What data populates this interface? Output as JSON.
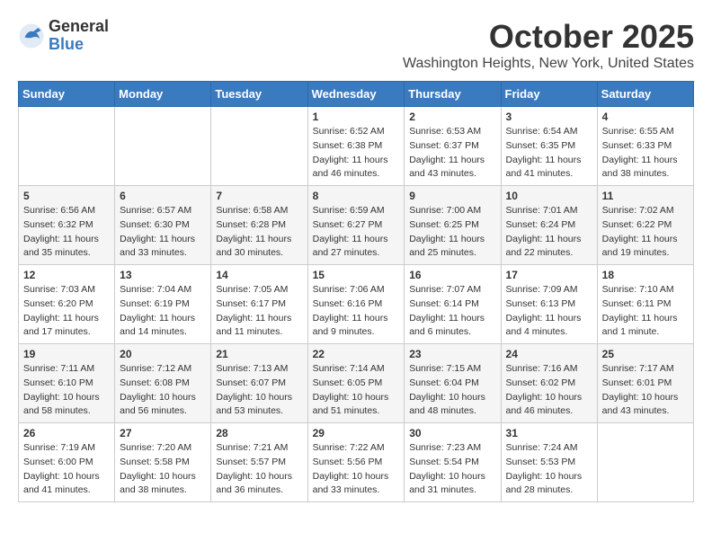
{
  "logo": {
    "general": "General",
    "blue": "Blue"
  },
  "title": "October 2025",
  "location": "Washington Heights, New York, United States",
  "days_of_week": [
    "Sunday",
    "Monday",
    "Tuesday",
    "Wednesday",
    "Thursday",
    "Friday",
    "Saturday"
  ],
  "weeks": [
    [
      {
        "day": "",
        "info": ""
      },
      {
        "day": "",
        "info": ""
      },
      {
        "day": "",
        "info": ""
      },
      {
        "day": "1",
        "info": "Sunrise: 6:52 AM\nSunset: 6:38 PM\nDaylight: 11 hours and 46 minutes."
      },
      {
        "day": "2",
        "info": "Sunrise: 6:53 AM\nSunset: 6:37 PM\nDaylight: 11 hours and 43 minutes."
      },
      {
        "day": "3",
        "info": "Sunrise: 6:54 AM\nSunset: 6:35 PM\nDaylight: 11 hours and 41 minutes."
      },
      {
        "day": "4",
        "info": "Sunrise: 6:55 AM\nSunset: 6:33 PM\nDaylight: 11 hours and 38 minutes."
      }
    ],
    [
      {
        "day": "5",
        "info": "Sunrise: 6:56 AM\nSunset: 6:32 PM\nDaylight: 11 hours and 35 minutes."
      },
      {
        "day": "6",
        "info": "Sunrise: 6:57 AM\nSunset: 6:30 PM\nDaylight: 11 hours and 33 minutes."
      },
      {
        "day": "7",
        "info": "Sunrise: 6:58 AM\nSunset: 6:28 PM\nDaylight: 11 hours and 30 minutes."
      },
      {
        "day": "8",
        "info": "Sunrise: 6:59 AM\nSunset: 6:27 PM\nDaylight: 11 hours and 27 minutes."
      },
      {
        "day": "9",
        "info": "Sunrise: 7:00 AM\nSunset: 6:25 PM\nDaylight: 11 hours and 25 minutes."
      },
      {
        "day": "10",
        "info": "Sunrise: 7:01 AM\nSunset: 6:24 PM\nDaylight: 11 hours and 22 minutes."
      },
      {
        "day": "11",
        "info": "Sunrise: 7:02 AM\nSunset: 6:22 PM\nDaylight: 11 hours and 19 minutes."
      }
    ],
    [
      {
        "day": "12",
        "info": "Sunrise: 7:03 AM\nSunset: 6:20 PM\nDaylight: 11 hours and 17 minutes."
      },
      {
        "day": "13",
        "info": "Sunrise: 7:04 AM\nSunset: 6:19 PM\nDaylight: 11 hours and 14 minutes."
      },
      {
        "day": "14",
        "info": "Sunrise: 7:05 AM\nSunset: 6:17 PM\nDaylight: 11 hours and 11 minutes."
      },
      {
        "day": "15",
        "info": "Sunrise: 7:06 AM\nSunset: 6:16 PM\nDaylight: 11 hours and 9 minutes."
      },
      {
        "day": "16",
        "info": "Sunrise: 7:07 AM\nSunset: 6:14 PM\nDaylight: 11 hours and 6 minutes."
      },
      {
        "day": "17",
        "info": "Sunrise: 7:09 AM\nSunset: 6:13 PM\nDaylight: 11 hours and 4 minutes."
      },
      {
        "day": "18",
        "info": "Sunrise: 7:10 AM\nSunset: 6:11 PM\nDaylight: 11 hours and 1 minute."
      }
    ],
    [
      {
        "day": "19",
        "info": "Sunrise: 7:11 AM\nSunset: 6:10 PM\nDaylight: 10 hours and 58 minutes."
      },
      {
        "day": "20",
        "info": "Sunrise: 7:12 AM\nSunset: 6:08 PM\nDaylight: 10 hours and 56 minutes."
      },
      {
        "day": "21",
        "info": "Sunrise: 7:13 AM\nSunset: 6:07 PM\nDaylight: 10 hours and 53 minutes."
      },
      {
        "day": "22",
        "info": "Sunrise: 7:14 AM\nSunset: 6:05 PM\nDaylight: 10 hours and 51 minutes."
      },
      {
        "day": "23",
        "info": "Sunrise: 7:15 AM\nSunset: 6:04 PM\nDaylight: 10 hours and 48 minutes."
      },
      {
        "day": "24",
        "info": "Sunrise: 7:16 AM\nSunset: 6:02 PM\nDaylight: 10 hours and 46 minutes."
      },
      {
        "day": "25",
        "info": "Sunrise: 7:17 AM\nSunset: 6:01 PM\nDaylight: 10 hours and 43 minutes."
      }
    ],
    [
      {
        "day": "26",
        "info": "Sunrise: 7:19 AM\nSunset: 6:00 PM\nDaylight: 10 hours and 41 minutes."
      },
      {
        "day": "27",
        "info": "Sunrise: 7:20 AM\nSunset: 5:58 PM\nDaylight: 10 hours and 38 minutes."
      },
      {
        "day": "28",
        "info": "Sunrise: 7:21 AM\nSunset: 5:57 PM\nDaylight: 10 hours and 36 minutes."
      },
      {
        "day": "29",
        "info": "Sunrise: 7:22 AM\nSunset: 5:56 PM\nDaylight: 10 hours and 33 minutes."
      },
      {
        "day": "30",
        "info": "Sunrise: 7:23 AM\nSunset: 5:54 PM\nDaylight: 10 hours and 31 minutes."
      },
      {
        "day": "31",
        "info": "Sunrise: 7:24 AM\nSunset: 5:53 PM\nDaylight: 10 hours and 28 minutes."
      },
      {
        "day": "",
        "info": ""
      }
    ]
  ]
}
